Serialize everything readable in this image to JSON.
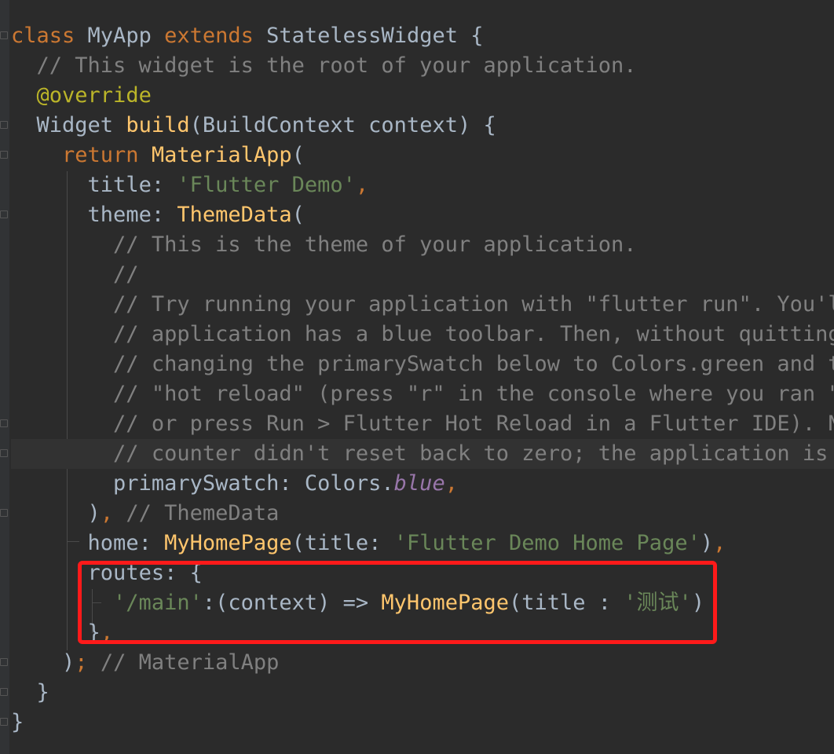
{
  "editor": {
    "lines": [
      {
        "indent": "",
        "tokens": [
          {
            "t": "class ",
            "c": "kw"
          },
          {
            "t": "MyApp ",
            "c": "plain"
          },
          {
            "t": "extends ",
            "c": "kw"
          },
          {
            "t": "StatelessWidget {",
            "c": "plain"
          }
        ]
      },
      {
        "indent": "  ",
        "tokens": [
          {
            "t": "// This widget is the root of your application.",
            "c": "cm"
          }
        ]
      },
      {
        "indent": "  ",
        "tokens": [
          {
            "t": "@",
            "c": "ann"
          },
          {
            "t": "override",
            "c": "ann"
          }
        ]
      },
      {
        "indent": "  ",
        "tokens": [
          {
            "t": "Widget ",
            "c": "plain"
          },
          {
            "t": "build",
            "c": "fn"
          },
          {
            "t": "(BuildContext context) {",
            "c": "plain"
          }
        ]
      },
      {
        "indent": "    ",
        "tokens": [
          {
            "t": "return ",
            "c": "kw"
          },
          {
            "t": "MaterialApp",
            "c": "fn"
          },
          {
            "t": "(",
            "c": "plain"
          }
        ]
      },
      {
        "indent": "      ",
        "tokens": [
          {
            "t": "title: ",
            "c": "plain"
          },
          {
            "t": "'Flutter Demo'",
            "c": "str"
          },
          {
            "t": ",",
            "c": "kw"
          }
        ]
      },
      {
        "indent": "      ",
        "tokens": [
          {
            "t": "theme: ",
            "c": "plain"
          },
          {
            "t": "ThemeData",
            "c": "fn"
          },
          {
            "t": "(",
            "c": "plain"
          }
        ]
      },
      {
        "indent": "        ",
        "tokens": [
          {
            "t": "// This is the theme of your application.",
            "c": "cm"
          }
        ]
      },
      {
        "indent": "        ",
        "tokens": [
          {
            "t": "//",
            "c": "cm"
          }
        ]
      },
      {
        "indent": "        ",
        "tokens": [
          {
            "t": "// Try running your application with \"flutter run\". You'll",
            "c": "cm"
          }
        ]
      },
      {
        "indent": "        ",
        "tokens": [
          {
            "t": "// application has a blue toolbar. Then, without quitting",
            "c": "cm"
          }
        ]
      },
      {
        "indent": "        ",
        "tokens": [
          {
            "t": "// changing the primarySwatch below to Colors.green and th",
            "c": "cm"
          }
        ]
      },
      {
        "indent": "        ",
        "tokens": [
          {
            "t": "// \"hot reload\" (press \"r\" in the console where you ran \"f",
            "c": "cm"
          }
        ]
      },
      {
        "indent": "        ",
        "tokens": [
          {
            "t": "// or press Run > Flutter Hot Reload in a Flutter IDE). No",
            "c": "cm"
          }
        ]
      },
      {
        "indent": "        ",
        "tokens": [
          {
            "t": "// counter didn't reset back to zero; the application is r",
            "c": "cm"
          }
        ]
      },
      {
        "indent": "        ",
        "tokens": [
          {
            "t": "primarySwatch: Colors.",
            "c": "plain"
          },
          {
            "t": "blue",
            "c": "stat"
          },
          {
            "t": ",",
            "c": "kw"
          }
        ]
      },
      {
        "indent": "      ",
        "tokens": [
          {
            "t": ")",
            "c": "plain"
          },
          {
            "t": ",",
            "c": "kw"
          },
          {
            "t": " // ThemeData",
            "c": "cm"
          }
        ]
      },
      {
        "indent": "      ",
        "tokens": [
          {
            "t": "home: ",
            "c": "plain"
          },
          {
            "t": "MyHomePage",
            "c": "fn"
          },
          {
            "t": "(title: ",
            "c": "plain"
          },
          {
            "t": "'Flutter Demo Home Page'",
            "c": "str"
          },
          {
            "t": ")",
            "c": "plain"
          },
          {
            "t": ",",
            "c": "kw"
          }
        ]
      },
      {
        "indent": "      ",
        "tokens": [
          {
            "t": "routes: {",
            "c": "plain"
          }
        ]
      },
      {
        "indent": "        ",
        "tokens": [
          {
            "t": "'/main'",
            "c": "str"
          },
          {
            "t": ":(context) => ",
            "c": "plain"
          },
          {
            "t": "MyHomePage",
            "c": "fn"
          },
          {
            "t": "(title : ",
            "c": "plain"
          },
          {
            "t": "'测试'",
            "c": "str"
          },
          {
            "t": ")",
            "c": "plain"
          }
        ]
      },
      {
        "indent": "      ",
        "tokens": [
          {
            "t": "}",
            "c": "plain"
          },
          {
            "t": ",",
            "c": "kw"
          }
        ]
      },
      {
        "indent": "    ",
        "tokens": [
          {
            "t": ")",
            "c": "plain"
          },
          {
            "t": ";",
            "c": "kw"
          },
          {
            "t": " // MaterialApp",
            "c": "cm"
          }
        ]
      },
      {
        "indent": "  ",
        "tokens": [
          {
            "t": "}",
            "c": "plain"
          }
        ]
      },
      {
        "indent": "",
        "tokens": [
          {
            "t": "}",
            "c": "plain"
          }
        ]
      }
    ],
    "fold_lines": [
      0,
      3,
      4,
      6,
      13,
      14,
      16,
      21,
      22,
      23
    ],
    "highlighted_lines": [
      14
    ]
  },
  "annotation": {
    "label": "routes highlight",
    "color": "#ff1a1a"
  },
  "colors": {
    "background": "#2b2b2b",
    "keyword": "#cc7832",
    "function": "#ffc66d",
    "string": "#6a8759",
    "comment": "#808080",
    "annotation": "#bbb529",
    "static_field": "#9876aa",
    "default_text": "#a9b7c6"
  }
}
